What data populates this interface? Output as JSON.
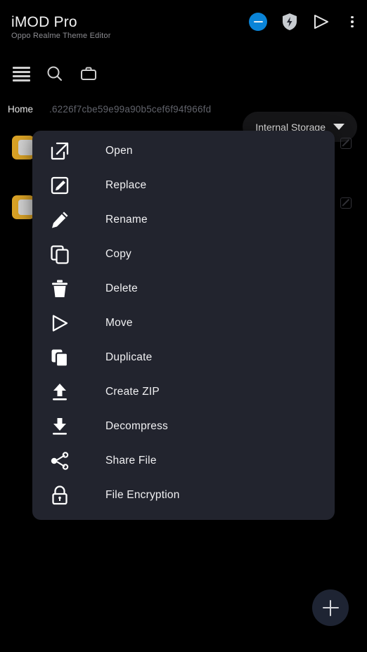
{
  "header": {
    "title": "iMOD Pro",
    "subtitle": "Oppo Realme Theme Editor",
    "icons": [
      {
        "name": "minus-circle-icon",
        "color": "#0a84d8"
      },
      {
        "name": "shield-bolt-icon",
        "color": "#c8ccd0"
      },
      {
        "name": "play-icon",
        "color": "#e6e6e6"
      },
      {
        "name": "kebab-menu-icon",
        "color": "#e6e6e6"
      }
    ]
  },
  "toolbar": {
    "icons": [
      {
        "name": "stacked-lines-icon"
      },
      {
        "name": "search-icon"
      },
      {
        "name": "briefcase-icon"
      }
    ],
    "storage": {
      "label": "Internal Storage",
      "caret": "chevron-down-icon"
    }
  },
  "breadcrumb": {
    "home": "Home",
    "path": ".6226f7cbe59e99a90b5cef6f94f966fd"
  },
  "file_rows": [
    {
      "icon": "folder-icon",
      "action": "edit-icon"
    },
    {
      "icon": "folder-icon",
      "action": "edit-icon"
    }
  ],
  "context_menu": {
    "items": [
      {
        "label": "Open",
        "icon": "open-external-icon"
      },
      {
        "label": "Replace",
        "icon": "box-pencil-icon"
      },
      {
        "label": "Rename",
        "icon": "pencil-icon"
      },
      {
        "label": "Copy",
        "icon": "copy-icon"
      },
      {
        "label": "Delete",
        "icon": "trash-icon"
      },
      {
        "label": "Move",
        "icon": "play-triangle-icon"
      },
      {
        "label": "Duplicate",
        "icon": "duplicate-icon"
      },
      {
        "label": "Create ZIP",
        "icon": "upload-arrow-icon"
      },
      {
        "label": "Decompress",
        "icon": "download-arrow-icon"
      },
      {
        "label": "Share File",
        "icon": "share-nodes-icon"
      },
      {
        "label": "File Encryption",
        "icon": "lock-icon"
      }
    ]
  },
  "fab": {
    "name": "add-button",
    "icon": "plus-icon",
    "color": "#1e2433"
  },
  "colors": {
    "background": "#000000",
    "menu_surface": "#22242e",
    "accent_blue": "#0a84d8",
    "folder_amber": "#d9a226",
    "text_primary": "#f0f0f2",
    "text_muted": "#61636b"
  }
}
